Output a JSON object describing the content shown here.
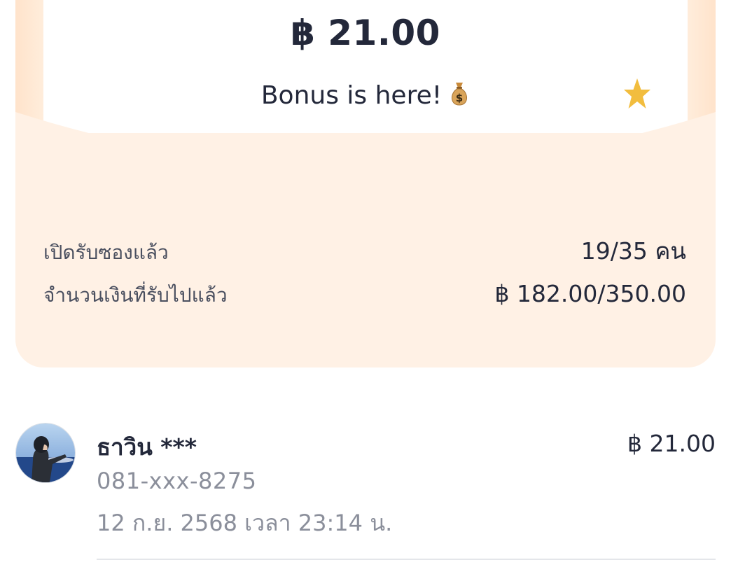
{
  "bonus": {
    "amount": "฿ 21.00",
    "message": "Bonus is here!",
    "icons": [
      "moneybag-icon",
      "star-icon"
    ]
  },
  "stats": [
    {
      "label": "เปิดรับซองแล้ว",
      "value": "19/35 คน"
    },
    {
      "label": "จำนวนเงินที่รับไปแล้ว",
      "value": "฿ 182.00/350.00"
    }
  ],
  "receivers": [
    {
      "name": "ธาวิน ***",
      "phone": "081-xxx-8275",
      "time": "12 ก.ย. 2568 เวลา 23:14 น.",
      "amount": "฿ 21.00"
    }
  ],
  "colors": {
    "card_background": "#fff1e5",
    "text_primary": "#23283a",
    "text_secondary": "#8b8f9b",
    "star": "#f2bd3e"
  }
}
